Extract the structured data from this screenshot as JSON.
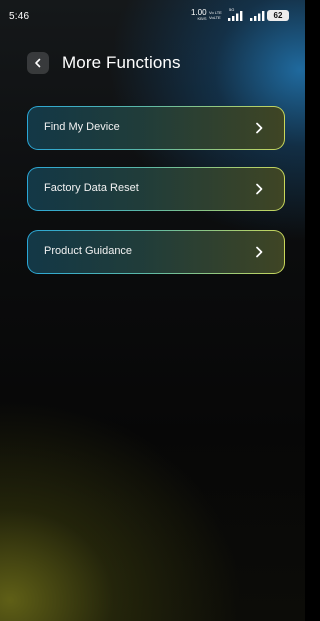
{
  "status_bar": {
    "time": "5:46",
    "net_speed_value": "1.00",
    "net_speed_unit": "KB/S",
    "volte_1": "Vo LTE",
    "volte_2": "VoLTE",
    "network_type": "5G",
    "battery": "62"
  },
  "header": {
    "title": "More Functions"
  },
  "menu": {
    "items": [
      {
        "label": "Find My Device"
      },
      {
        "label": "Factory Data Reset"
      },
      {
        "label": "Product Guidance"
      }
    ]
  },
  "colors": {
    "border_start": "#2aa6d6",
    "border_end": "#c8d65a",
    "glow_top": "#206ea5",
    "glow_bottom": "#6e6e19"
  },
  "icons": {
    "back": "chevron-left-icon",
    "item_arrow": "chevron-right-icon",
    "signal": "signal-bars-icon"
  }
}
